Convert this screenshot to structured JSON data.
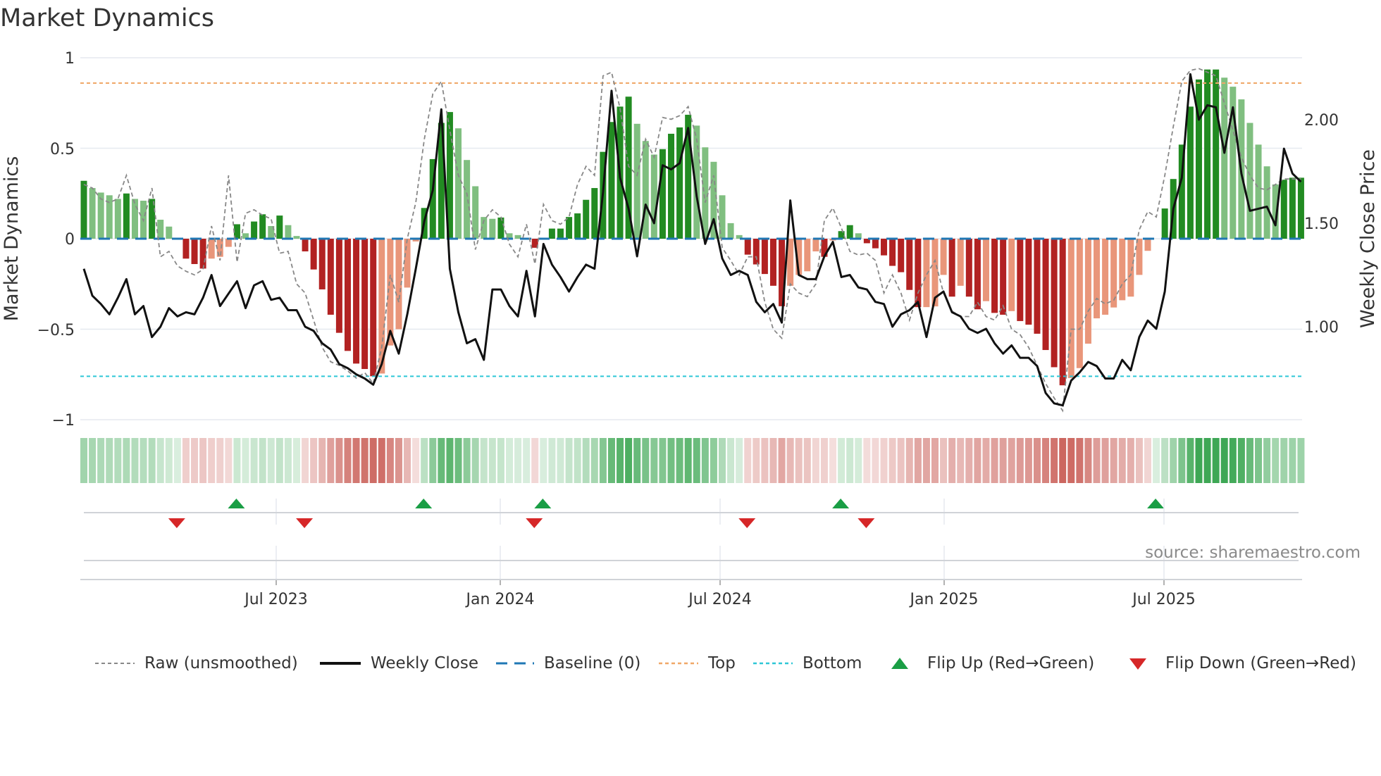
{
  "title": "Market Dynamics",
  "source": "source: sharemaestro.com",
  "colors": {
    "bar_green_rising": "#228b22",
    "bar_green_falling": "#80bf80",
    "bar_red_falling": "#b22222",
    "bar_red_rising": "#e9967a",
    "raw": "#888888",
    "close": "#111111",
    "baseline": "#1f77b4",
    "top": "#f0a868",
    "bottom": "#2ec7d6",
    "flip_up": "#1a9e45",
    "flip_down": "#d62728",
    "grid": "#e6e9ef"
  },
  "chart_data": {
    "type": "bar",
    "title": "Market Dynamics",
    "ylabel": "Market Dynamics",
    "ylabel_right": "Weekly Close Price",
    "ylim": [
      -1,
      1
    ],
    "ylim_right": [
      0.54,
      2.29
    ],
    "yticks": [
      "1",
      "0.5",
      "0",
      "−0.5",
      "−1"
    ],
    "yticks_right": [
      "2.00",
      "1.50",
      "1.00"
    ],
    "xticks": [
      "Jul 2023",
      "Jan 2024",
      "Jul 2024",
      "Jan 2025",
      "Jul 2025"
    ],
    "start_week": "2023-01-24",
    "interval_days": 7,
    "top_level": 0.86,
    "bottom_level": -0.76,
    "baseline": 0,
    "dynamics": [
      0.32,
      0.28,
      0.255,
      0.24,
      0.22,
      0.25,
      0.22,
      0.21,
      0.22,
      0.105,
      0.067,
      0.0,
      -0.11,
      -0.14,
      -0.165,
      -0.11,
      -0.1,
      -0.045,
      0.08,
      0.03,
      0.095,
      0.135,
      0.07,
      0.128,
      0.075,
      0.015,
      -0.07,
      -0.17,
      -0.28,
      -0.42,
      -0.52,
      -0.62,
      -0.69,
      -0.72,
      -0.76,
      -0.745,
      -0.59,
      -0.5,
      -0.27,
      -0.015,
      0.17,
      0.44,
      0.64,
      0.7,
      0.61,
      0.435,
      0.29,
      0.12,
      0.11,
      0.117,
      0.03,
      0.02,
      0.005,
      -0.05,
      0.005,
      0.056,
      0.056,
      0.12,
      0.14,
      0.215,
      0.28,
      0.48,
      0.645,
      0.73,
      0.785,
      0.635,
      0.54,
      0.465,
      0.495,
      0.58,
      0.615,
      0.685,
      0.625,
      0.505,
      0.425,
      0.24,
      0.086,
      0.02,
      -0.088,
      -0.142,
      -0.195,
      -0.26,
      -0.373,
      -0.26,
      -0.2,
      -0.18,
      -0.07,
      -0.1,
      -0.01,
      0.042,
      0.075,
      0.03,
      -0.025,
      -0.053,
      -0.092,
      -0.15,
      -0.185,
      -0.283,
      -0.378,
      -0.378,
      -0.374,
      -0.2,
      -0.32,
      -0.26,
      -0.32,
      -0.39,
      -0.345,
      -0.41,
      -0.42,
      -0.4,
      -0.455,
      -0.475,
      -0.525,
      -0.615,
      -0.71,
      -0.81,
      -0.77,
      -0.715,
      -0.58,
      -0.44,
      -0.42,
      -0.38,
      -0.34,
      -0.32,
      -0.2,
      -0.067,
      0.0,
      0.167,
      0.33,
      0.52,
      0.73,
      0.88,
      0.935,
      0.935,
      0.89,
      0.84,
      0.77,
      0.64,
      0.52,
      0.4,
      0.3,
      0.326,
      0.337,
      0.337
    ],
    "raw": [
      0.3,
      0.28,
      0.22,
      0.2,
      0.22,
      0.35,
      0.19,
      0.1,
      0.28,
      -0.1,
      -0.07,
      -0.15,
      -0.18,
      -0.2,
      -0.17,
      0.07,
      -0.12,
      0.35,
      -0.13,
      0.14,
      0.16,
      0.13,
      0.11,
      -0.08,
      -0.07,
      -0.25,
      -0.3,
      -0.45,
      -0.6,
      -0.68,
      -0.7,
      -0.73,
      -0.77,
      -0.74,
      -0.8,
      -0.6,
      -0.2,
      -0.35,
      0.0,
      0.2,
      0.55,
      0.8,
      0.87,
      0.6,
      0.35,
      0.25,
      -0.06,
      0.1,
      0.16,
      0.12,
      -0.03,
      -0.1,
      0.08,
      -0.14,
      0.19,
      0.1,
      0.08,
      0.12,
      0.3,
      0.4,
      0.35,
      0.9,
      0.92,
      0.72,
      0.4,
      0.35,
      0.55,
      0.45,
      0.67,
      0.66,
      0.68,
      0.73,
      0.55,
      0.2,
      0.35,
      -0.05,
      -0.12,
      -0.2,
      -0.1,
      -0.1,
      -0.35,
      -0.5,
      -0.55,
      -0.25,
      -0.3,
      -0.32,
      -0.25,
      0.1,
      0.17,
      0.06,
      -0.07,
      -0.09,
      -0.08,
      -0.12,
      -0.3,
      -0.2,
      -0.3,
      -0.45,
      -0.3,
      -0.2,
      -0.12,
      -0.3,
      -0.4,
      -0.43,
      -0.43,
      -0.35,
      -0.43,
      -0.45,
      -0.37,
      -0.5,
      -0.53,
      -0.6,
      -0.7,
      -0.8,
      -0.88,
      -0.95,
      -0.5,
      -0.5,
      -0.4,
      -0.33,
      -0.36,
      -0.34,
      -0.25,
      -0.2,
      0.05,
      0.15,
      0.12,
      0.35,
      0.62,
      0.87,
      0.93,
      0.94,
      0.92,
      0.9,
      0.75,
      0.6,
      0.45,
      0.35,
      0.28,
      0.27,
      0.3,
      0.33,
      0.33,
      0.33
    ],
    "weekly_close": [
      1.28,
      1.15,
      1.11,
      1.06,
      1.14,
      1.23,
      1.06,
      1.1,
      0.95,
      1.0,
      1.09,
      1.05,
      1.07,
      1.06,
      1.14,
      1.25,
      1.1,
      1.16,
      1.22,
      1.09,
      1.2,
      1.22,
      1.13,
      1.14,
      1.08,
      1.08,
      1.0,
      0.98,
      0.92,
      0.89,
      0.82,
      0.8,
      0.77,
      0.75,
      0.72,
      0.82,
      0.98,
      0.87,
      1.06,
      1.28,
      1.51,
      1.66,
      2.05,
      1.28,
      1.07,
      0.92,
      0.94,
      0.84,
      1.18,
      1.18,
      1.1,
      1.05,
      1.27,
      1.05,
      1.4,
      1.3,
      1.24,
      1.17,
      1.24,
      1.3,
      1.28,
      1.65,
      2.14,
      1.72,
      1.57,
      1.34,
      1.59,
      1.5,
      1.78,
      1.76,
      1.79,
      1.96,
      1.63,
      1.4,
      1.52,
      1.33,
      1.25,
      1.27,
      1.25,
      1.12,
      1.07,
      1.11,
      1.02,
      1.61,
      1.25,
      1.23,
      1.23,
      1.34,
      1.41,
      1.24,
      1.25,
      1.19,
      1.18,
      1.12,
      1.11,
      1.0,
      1.06,
      1.08,
      1.12,
      0.95,
      1.14,
      1.17,
      1.07,
      1.05,
      0.99,
      0.97,
      0.99,
      0.92,
      0.87,
      0.91,
      0.85,
      0.85,
      0.81,
      0.68,
      0.63,
      0.62,
      0.74,
      0.78,
      0.83,
      0.81,
      0.75,
      0.75,
      0.84,
      0.79,
      0.95,
      1.03,
      0.99,
      1.17,
      1.57,
      1.72,
      2.22,
      2.0,
      2.07,
      2.06,
      1.84,
      2.06,
      1.74,
      1.56,
      1.57,
      1.58,
      1.49,
      1.86,
      1.74,
      1.7
    ],
    "flip_up_weeks": [
      18,
      40,
      54,
      89,
      126
    ],
    "flip_down_weeks": [
      11,
      26,
      53,
      78,
      92
    ],
    "legend": {
      "position": "bottom",
      "items": [
        "Raw (unsmoothed)",
        "Weekly Close",
        "Baseline (0)",
        "Top",
        "Bottom",
        "Flip Up (Red→Green)",
        "Flip Down (Green→Red)"
      ]
    }
  }
}
